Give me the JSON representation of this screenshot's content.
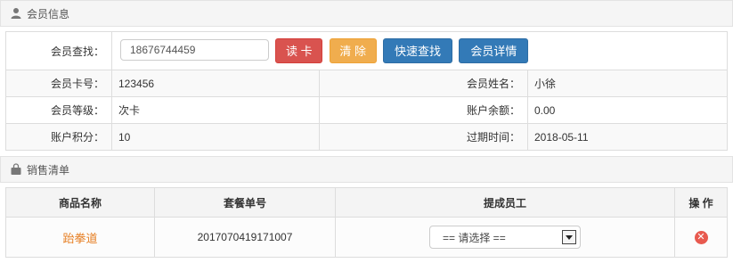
{
  "member_section": {
    "title": "会员信息",
    "icon": "user-icon",
    "search_label": "会员查找：",
    "search_value": "18676744459",
    "buttons": {
      "read_card": "读 卡",
      "clear": "清 除",
      "quick_search": "快速查找",
      "member_detail": "会员详情"
    },
    "fields": {
      "card_no_label": "会员卡号：",
      "card_no_value": "123456",
      "name_label": "会员姓名：",
      "name_value": "小徐",
      "level_label": "会员等级：",
      "level_value": "次卡",
      "balance_label": "账户余额：",
      "balance_value": "0.00",
      "points_label": "账户积分：",
      "points_value": "10",
      "expire_label": "过期时间：",
      "expire_value": "2018-05-11"
    }
  },
  "sales_section": {
    "title": "销售清单",
    "icon": "shopping-bag-icon",
    "columns": [
      "商品名称",
      "套餐单号",
      "提成员工",
      "操 作"
    ],
    "rows": [
      {
        "product": "跆拳道",
        "package_no": "2017070419171007",
        "staff_select": "== 请选择 =="
      }
    ]
  },
  "colors": {
    "read_card": "#d9534f",
    "clear": "#f0ad4e",
    "blue_buttons": "#337ab7",
    "product_link": "#e67e22",
    "delete": "#e85a4f"
  }
}
